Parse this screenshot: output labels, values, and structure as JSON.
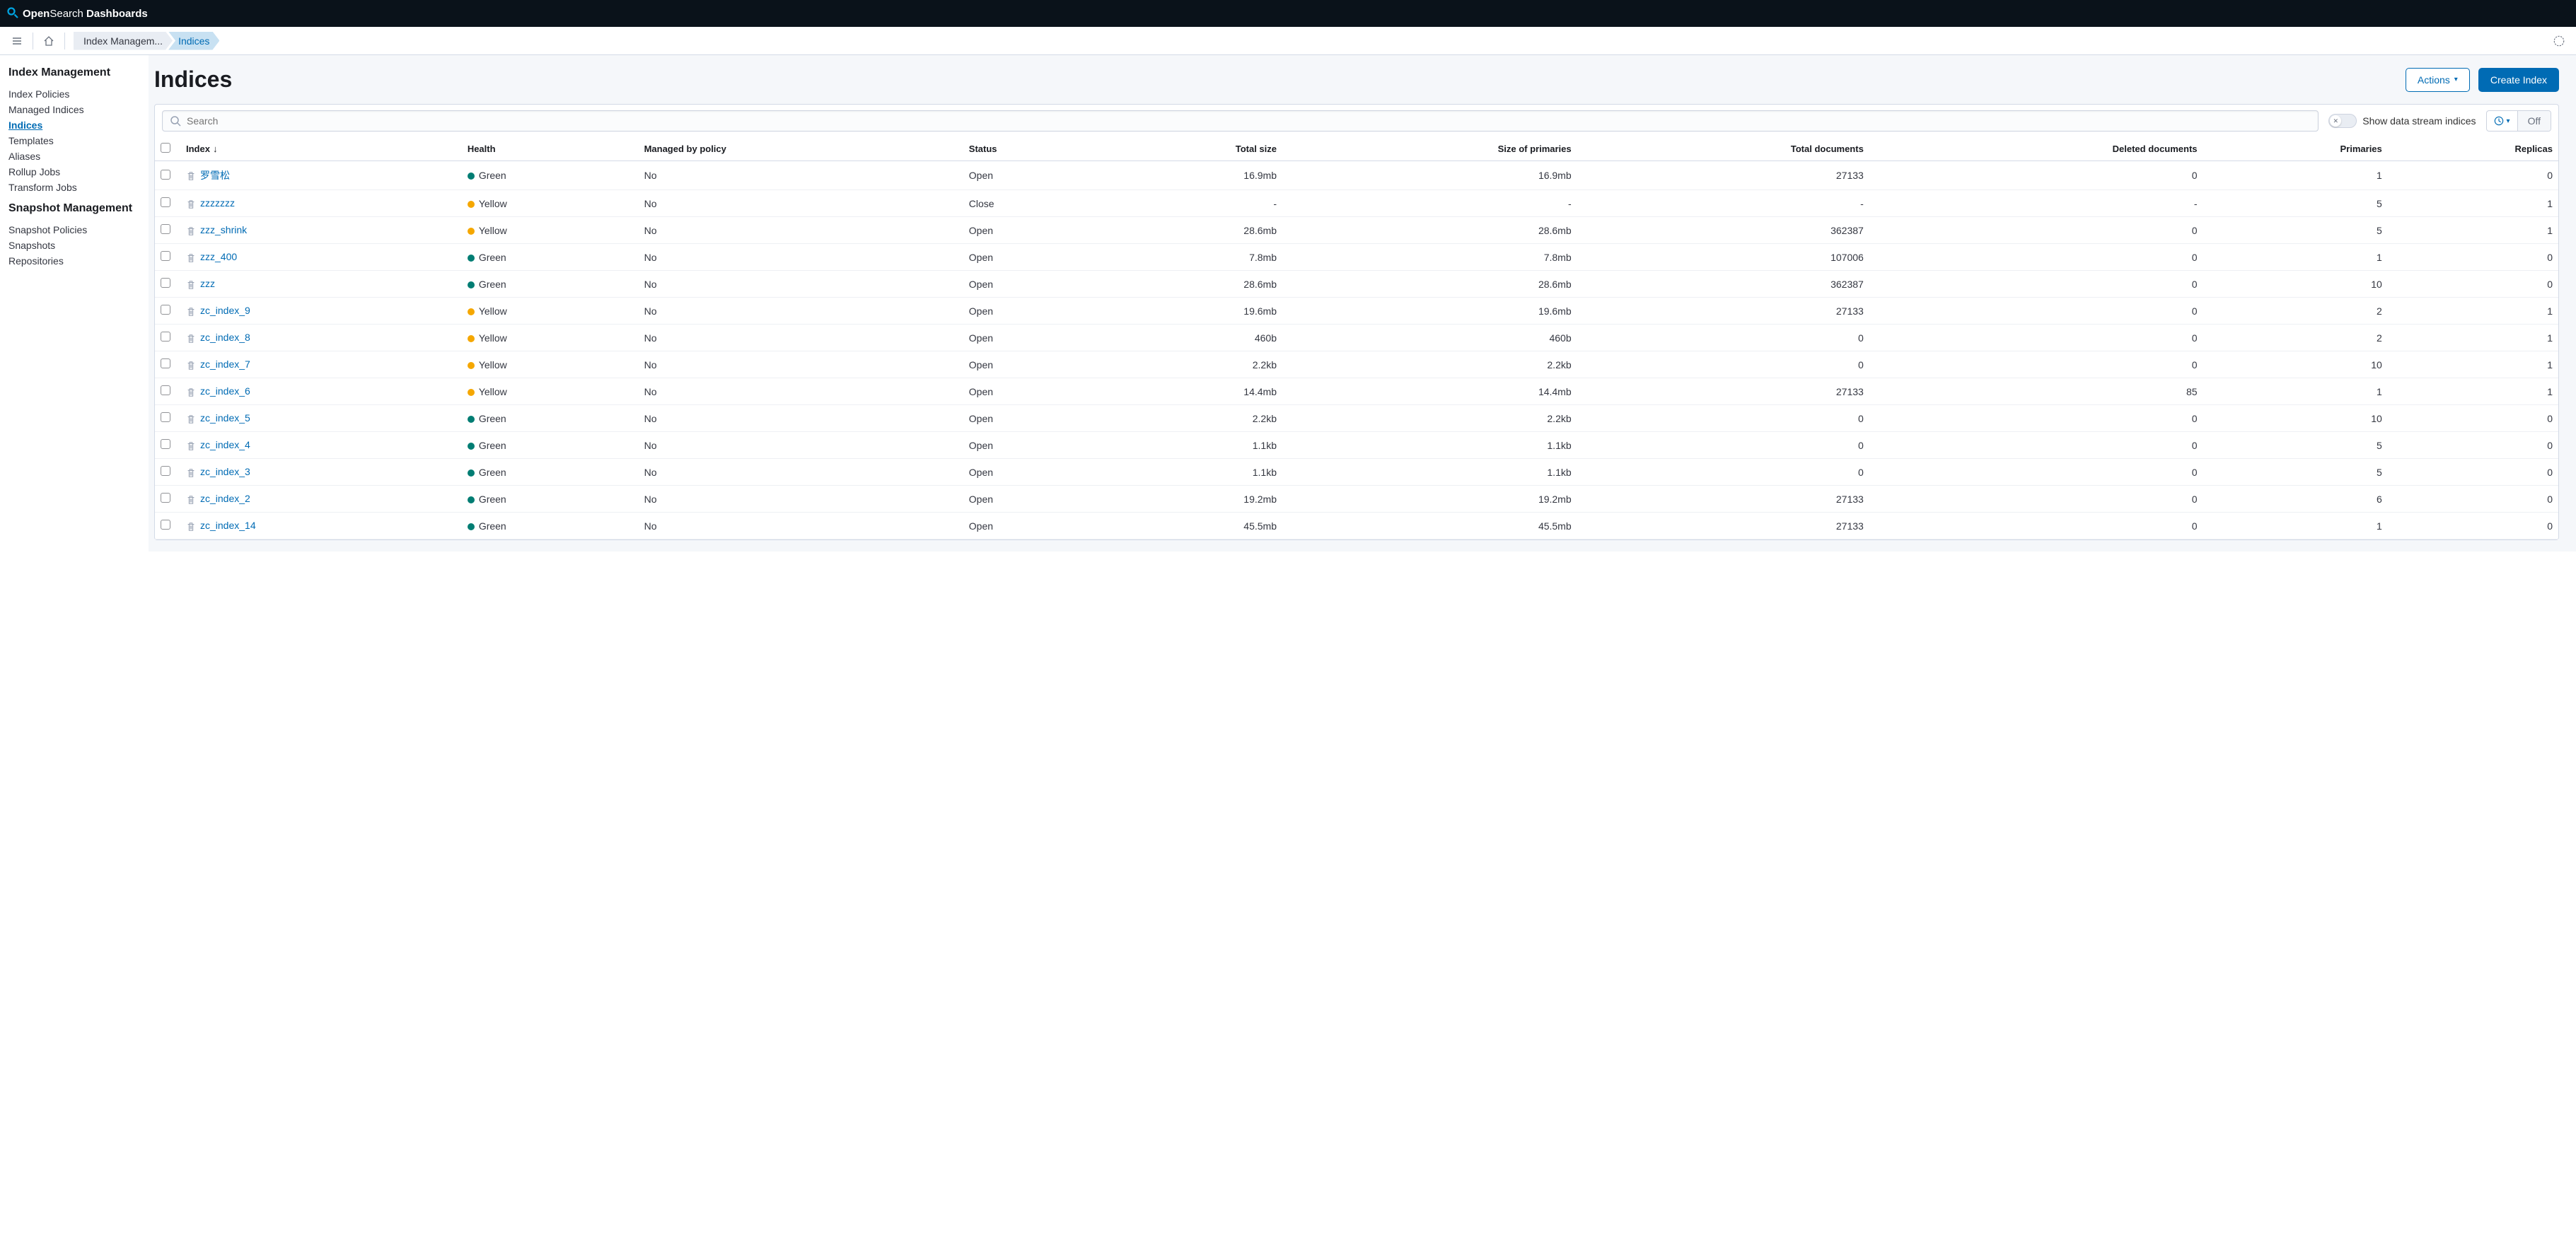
{
  "brand": {
    "bold1": "Open",
    "light": "Search",
    "bold2": " Dashboards"
  },
  "breadcrumbs": [
    {
      "label": "Index Managem..."
    },
    {
      "label": "Indices"
    }
  ],
  "sidebar": {
    "group1_title": "Index Management",
    "group1_items": [
      {
        "label": "Index Policies"
      },
      {
        "label": "Managed Indices"
      },
      {
        "label": "Indices"
      },
      {
        "label": "Templates"
      },
      {
        "label": "Aliases"
      },
      {
        "label": "Rollup Jobs"
      },
      {
        "label": "Transform Jobs"
      }
    ],
    "group2_title": "Snapshot Management",
    "group2_items": [
      {
        "label": "Snapshot Policies"
      },
      {
        "label": "Snapshots"
      },
      {
        "label": "Repositories"
      }
    ]
  },
  "page": {
    "title": "Indices",
    "actions_label": "Actions",
    "create_label": "Create Index",
    "search_placeholder": "Search",
    "toggle_label": "Show data stream indices",
    "refresh_off": "Off"
  },
  "columns": {
    "index": "Index",
    "health": "Health",
    "managed": "Managed by policy",
    "status": "Status",
    "total_size": "Total size",
    "size_primaries": "Size of primaries",
    "total_docs": "Total documents",
    "deleted_docs": "Deleted documents",
    "primaries": "Primaries",
    "replicas": "Replicas"
  },
  "health_colors": {
    "Green": "#017d73",
    "Yellow": "#f5a700"
  },
  "rows": [
    {
      "name": "罗雪松",
      "health": "Green",
      "managed": "No",
      "status": "Open",
      "total_size": "16.9mb",
      "size_primaries": "16.9mb",
      "total_docs": "27133",
      "deleted_docs": "0",
      "primaries": "1",
      "replicas": "0"
    },
    {
      "name": "zzzzzzz",
      "health": "Yellow",
      "managed": "No",
      "status": "Close",
      "total_size": "-",
      "size_primaries": "-",
      "total_docs": "-",
      "deleted_docs": "-",
      "primaries": "5",
      "replicas": "1"
    },
    {
      "name": "zzz_shrink",
      "health": "Yellow",
      "managed": "No",
      "status": "Open",
      "total_size": "28.6mb",
      "size_primaries": "28.6mb",
      "total_docs": "362387",
      "deleted_docs": "0",
      "primaries": "5",
      "replicas": "1"
    },
    {
      "name": "zzz_400",
      "health": "Green",
      "managed": "No",
      "status": "Open",
      "total_size": "7.8mb",
      "size_primaries": "7.8mb",
      "total_docs": "107006",
      "deleted_docs": "0",
      "primaries": "1",
      "replicas": "0"
    },
    {
      "name": "zzz",
      "health": "Green",
      "managed": "No",
      "status": "Open",
      "total_size": "28.6mb",
      "size_primaries": "28.6mb",
      "total_docs": "362387",
      "deleted_docs": "0",
      "primaries": "10",
      "replicas": "0"
    },
    {
      "name": "zc_index_9",
      "health": "Yellow",
      "managed": "No",
      "status": "Open",
      "total_size": "19.6mb",
      "size_primaries": "19.6mb",
      "total_docs": "27133",
      "deleted_docs": "0",
      "primaries": "2",
      "replicas": "1"
    },
    {
      "name": "zc_index_8",
      "health": "Yellow",
      "managed": "No",
      "status": "Open",
      "total_size": "460b",
      "size_primaries": "460b",
      "total_docs": "0",
      "deleted_docs": "0",
      "primaries": "2",
      "replicas": "1"
    },
    {
      "name": "zc_index_7",
      "health": "Yellow",
      "managed": "No",
      "status": "Open",
      "total_size": "2.2kb",
      "size_primaries": "2.2kb",
      "total_docs": "0",
      "deleted_docs": "0",
      "primaries": "10",
      "replicas": "1"
    },
    {
      "name": "zc_index_6",
      "health": "Yellow",
      "managed": "No",
      "status": "Open",
      "total_size": "14.4mb",
      "size_primaries": "14.4mb",
      "total_docs": "27133",
      "deleted_docs": "85",
      "primaries": "1",
      "replicas": "1"
    },
    {
      "name": "zc_index_5",
      "health": "Green",
      "managed": "No",
      "status": "Open",
      "total_size": "2.2kb",
      "size_primaries": "2.2kb",
      "total_docs": "0",
      "deleted_docs": "0",
      "primaries": "10",
      "replicas": "0"
    },
    {
      "name": "zc_index_4",
      "health": "Green",
      "managed": "No",
      "status": "Open",
      "total_size": "1.1kb",
      "size_primaries": "1.1kb",
      "total_docs": "0",
      "deleted_docs": "0",
      "primaries": "5",
      "replicas": "0"
    },
    {
      "name": "zc_index_3",
      "health": "Green",
      "managed": "No",
      "status": "Open",
      "total_size": "1.1kb",
      "size_primaries": "1.1kb",
      "total_docs": "0",
      "deleted_docs": "0",
      "primaries": "5",
      "replicas": "0"
    },
    {
      "name": "zc_index_2",
      "health": "Green",
      "managed": "No",
      "status": "Open",
      "total_size": "19.2mb",
      "size_primaries": "19.2mb",
      "total_docs": "27133",
      "deleted_docs": "0",
      "primaries": "6",
      "replicas": "0"
    },
    {
      "name": "zc_index_14",
      "health": "Green",
      "managed": "No",
      "status": "Open",
      "total_size": "45.5mb",
      "size_primaries": "45.5mb",
      "total_docs": "27133",
      "deleted_docs": "0",
      "primaries": "1",
      "replicas": "0"
    }
  ]
}
